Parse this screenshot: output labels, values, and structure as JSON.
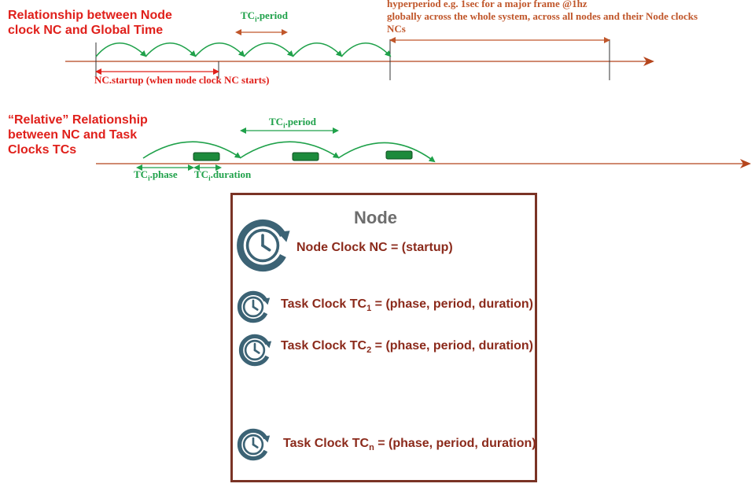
{
  "global_section": {
    "heading": "Relationship between Node clock NC and Global Time",
    "tc_period_label": "TCi.period",
    "hyperperiod_note": [
      "hyperperiod e.g. 1sec for a major frame @1hz",
      "globally across the whole system, across all nodes and their Node clocks",
      "NCs"
    ],
    "startup_label": "NC.startup (when node clock NC starts)"
  },
  "relative_section": {
    "heading": "“Relative” Relationship between NC and Task Clocks TCs",
    "tc_period_label": "TCi.period",
    "phase_label": "TCi.phase",
    "duration_label": "TCi.duration"
  },
  "node": {
    "title": "Node",
    "node_clock": "Node Clock NC = (startup)",
    "task_clocks": [
      {
        "prefix": "Task  Clock TC",
        "sub": "1",
        "suffix": " = (phase, period, duration)"
      },
      {
        "prefix": "Task  Clock TC",
        "sub": "2",
        "suffix": " = (phase, period, duration)"
      },
      {
        "prefix": "Task  Clock TC",
        "sub": "n",
        "suffix": " = (phase, period, duration)"
      }
    ]
  },
  "colors": {
    "red": "#e0201b",
    "green": "#1fa14a",
    "dark_red": "#8b2a1b",
    "orange_note": "#c0562a",
    "timeline": "#b5451c",
    "clock_icon": "#3c6375",
    "node_border": "#7a3325"
  }
}
